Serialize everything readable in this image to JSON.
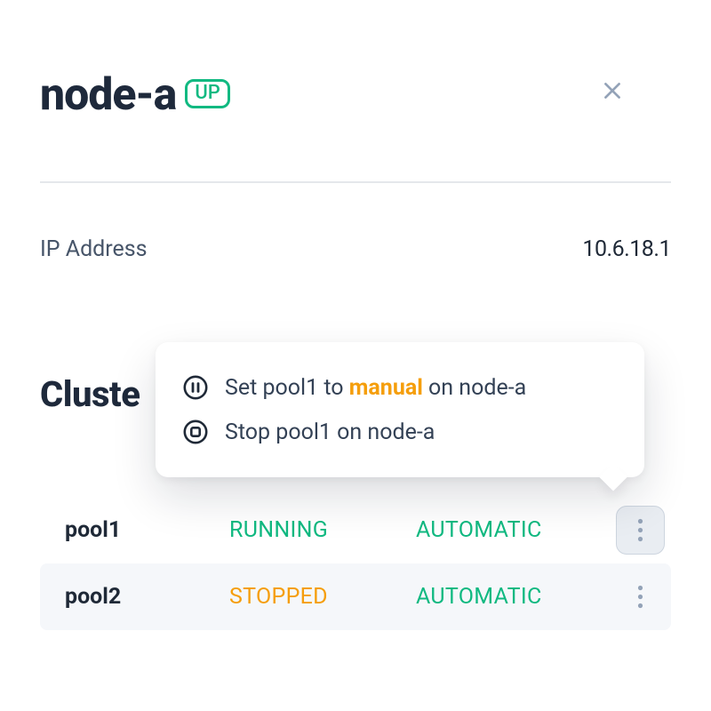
{
  "header": {
    "title": "node-a",
    "status_badge": "UP"
  },
  "info": {
    "ip_label": "IP Address",
    "ip_value": "10.6.18.1"
  },
  "section": {
    "title_cut": "Cluste"
  },
  "pools": [
    {
      "name": "pool1",
      "status": "RUNNING",
      "status_color": "green",
      "mode": "AUTOMATIC",
      "menu_active": true
    },
    {
      "name": "pool2",
      "status": "STOPPED",
      "status_color": "amber",
      "mode": "AUTOMATIC",
      "menu_active": false
    }
  ],
  "popover": {
    "items": [
      {
        "icon": "pause",
        "pre": "Set pool1 to ",
        "accent": "manual",
        "post": " on node-a"
      },
      {
        "icon": "stop",
        "pre": "Stop pool1 on node-a",
        "accent": "",
        "post": ""
      }
    ]
  }
}
